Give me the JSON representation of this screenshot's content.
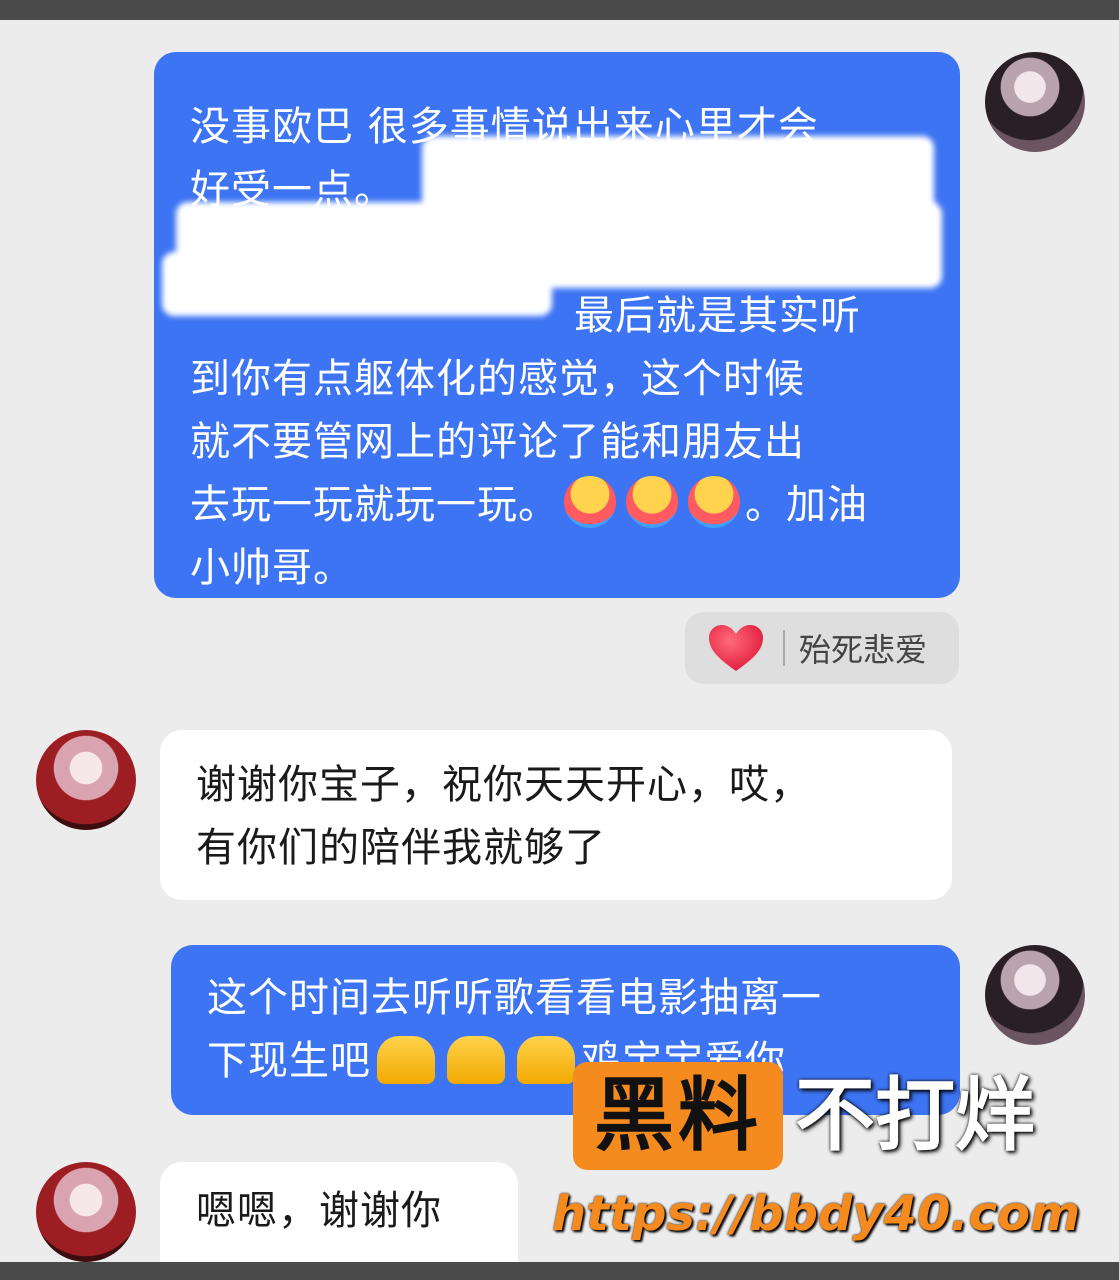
{
  "messages": [
    {
      "lines": [
        "没事欧巴 很多事情说出来心里才会",
        "好受一点。",
        "最后就是其实听",
        "到你有点躯体化的感觉，这个时候",
        "就不要管网上的评论了能和朋友出",
        "去玩一玩就玩一玩。",
        "。加油",
        "小帅哥。"
      ]
    },
    {
      "lines": [
        "谢谢你宝子，祝你天天开心，哎，",
        "有你们的陪伴我就够了"
      ]
    },
    {
      "lines": [
        "这个时间去听听歌看看电影抽离一",
        "下现生吧",
        "鸡宝宝爱你"
      ]
    },
    {
      "lines": [
        "嗯嗯，谢谢你"
      ]
    }
  ],
  "reaction": {
    "icon": "heart-icon",
    "name": "殆死悲爱"
  },
  "watermark": {
    "badge": "黑料",
    "text": "不打烊",
    "url": "https://bbdy40.com"
  },
  "colors": {
    "outgoing_bubble": "#3d74f3",
    "incoming_bubble": "#ffffff",
    "watermark_orange": "#f58a1f"
  }
}
